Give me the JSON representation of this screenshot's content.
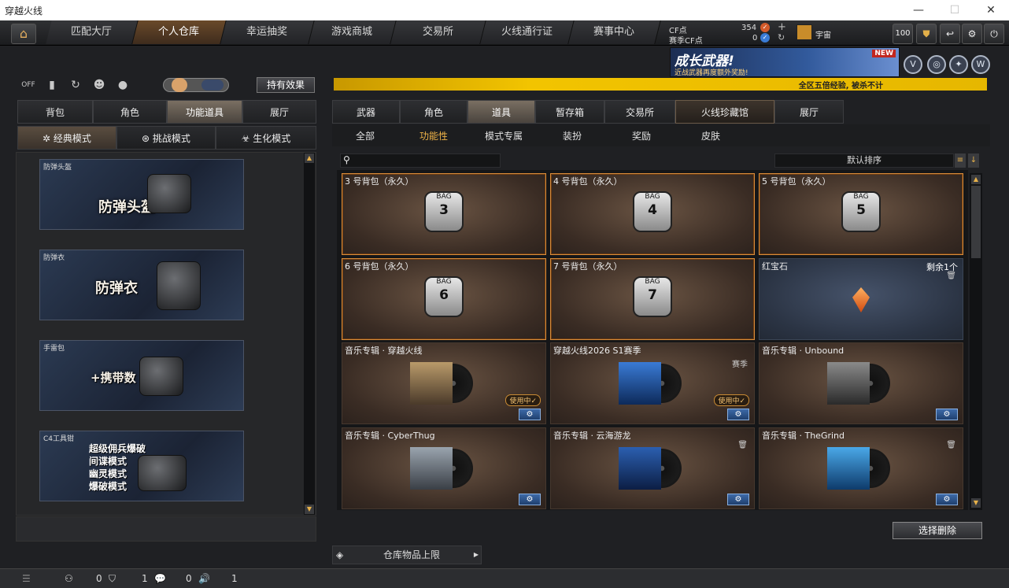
{
  "window": {
    "title": "穿越火线",
    "min": "—",
    "max": "☐",
    "close": "✕"
  },
  "nav": {
    "home_icon": "home-icon",
    "tabs": [
      "匹配大厅",
      "个人仓库",
      "幸运抽奖",
      "游戏商城",
      "交易所",
      "火线通行证",
      "赛事中心"
    ],
    "active": 1,
    "cf_label": "CF点",
    "cf_value": "354",
    "season_cf_label": "赛季CF点",
    "season_cf_value": "0",
    "plus": "+",
    "refresh": "↻",
    "username": "宇宙",
    "level": "100"
  },
  "banner": {
    "title": "成长武器!",
    "subtitle": "近战武器再度额外奖励!",
    "badge": "NEW"
  },
  "notice": "全区五倍经验, 被杀不计",
  "left": {
    "toggle_off": "OFF",
    "effect_button": "持有效果",
    "tabs": [
      "背包",
      "角色",
      "功能道具",
      "展厅"
    ],
    "active_tab": 2,
    "modes": [
      "经典模式",
      "挑战模式",
      "生化模式"
    ],
    "active_mode": 0,
    "items": [
      {
        "label": "防弹头盔",
        "big": "防弹头盔"
      },
      {
        "label": "防弹衣",
        "big": "防弹衣"
      },
      {
        "label": "手雷包",
        "big": "+携带数"
      },
      {
        "label": "C4工具钳",
        "modes": [
          "超级佣兵爆破",
          "间谍模式",
          "幽灵模式",
          "爆破模式"
        ]
      }
    ]
  },
  "right": {
    "tabs": [
      "武器",
      "角色",
      "道具",
      "暂存箱",
      "交易所",
      "火线珍藏馆",
      "展厅"
    ],
    "active_tab": 2,
    "subtabs": [
      "全部",
      "功能性",
      "模式专属",
      "装扮",
      "奖励",
      "皮肤"
    ],
    "active_subtab": 1,
    "sort_label": "默认排序",
    "cards": [
      {
        "title": "3 号背包（永久）",
        "bag": "3"
      },
      {
        "title": "4 号背包（永久）",
        "bag": "4"
      },
      {
        "title": "5 号背包（永久）",
        "bag": "5"
      },
      {
        "title": "6 号背包（永久）",
        "bag": "6"
      },
      {
        "title": "7 号背包（永久）",
        "bag": "7"
      },
      {
        "title": "红宝石",
        "remain": "剩余1个"
      },
      {
        "title": "音乐专辑 · 穿越火线",
        "inuse": "使用中✓"
      },
      {
        "title": "穿越火线2026 S1赛季",
        "season": "赛季",
        "inuse": "使用中✓"
      },
      {
        "title": "音乐专辑 · Unbound"
      },
      {
        "title": "音乐专辑 · CyberThug"
      },
      {
        "title": "音乐专辑 · 云海游龙"
      },
      {
        "title": "音乐专辑 · TheGrind"
      }
    ],
    "bag_text": "BAG",
    "delete_button": "选择删除",
    "capacity": "仓库物品上限"
  },
  "status": {
    "v1": "0",
    "v2": "1",
    "v3": "0",
    "v4": "1"
  }
}
